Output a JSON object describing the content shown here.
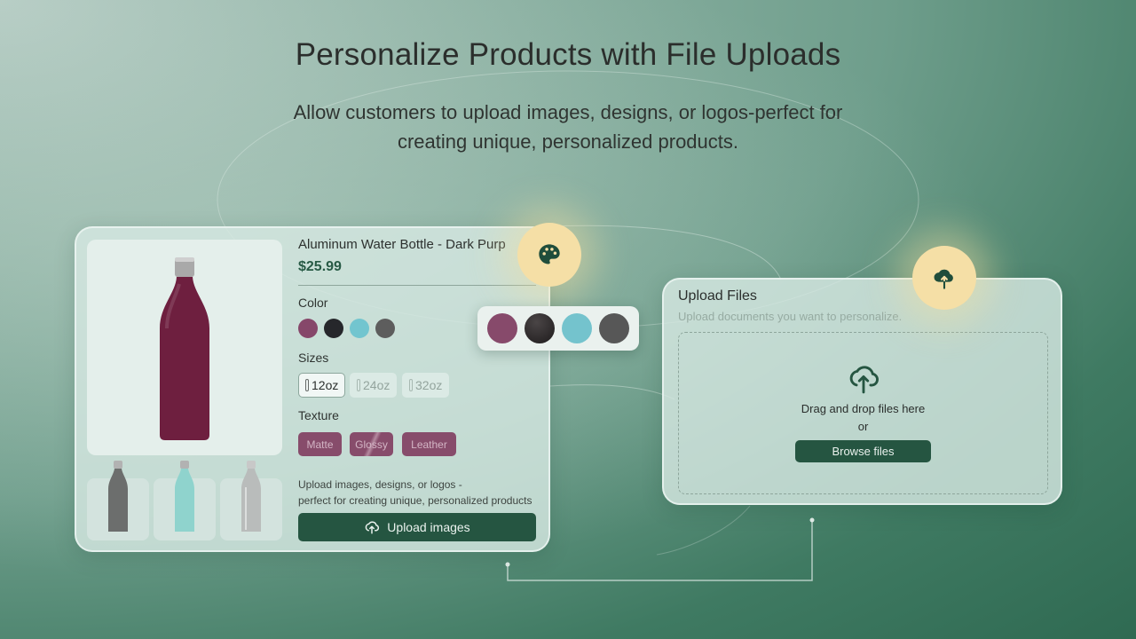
{
  "hero": {
    "title": "Personalize Products with File Uploads",
    "subtitle": "Allow customers to upload images, designs, or logos-perfect for creating unique, personalized products."
  },
  "product": {
    "title": "Aluminum Water Bottle - Dark Purp",
    "price": "$25.99",
    "main_image_color": "#6e1f3f",
    "thumbnails": [
      {
        "name": "gray",
        "color": "#6c6e6d"
      },
      {
        "name": "teal",
        "color": "#8fd3cd"
      },
      {
        "name": "silver",
        "color": "#b9bcbb"
      }
    ],
    "color_label": "Color",
    "colors": [
      {
        "name": "dark-purple",
        "hex": "#86476a"
      },
      {
        "name": "black",
        "hex": "#26272b"
      },
      {
        "name": "light-blue",
        "hex": "#72c5cf"
      },
      {
        "name": "gray",
        "hex": "#5d5d5d"
      }
    ],
    "sizes_label": "Sizes",
    "sizes": [
      {
        "label": "12oz",
        "selected": true
      },
      {
        "label": "24oz",
        "selected": false
      },
      {
        "label": "32oz",
        "selected": false
      }
    ],
    "texture_label": "Texture",
    "textures": [
      "Matte",
      "Glossy",
      "Leather"
    ],
    "help_line1": "Upload images, designs, or logos -",
    "help_line2": "perfect for creating unique, personalized products",
    "upload_button": "Upload images"
  },
  "color_popover": {
    "colors": [
      {
        "name": "dark-purple",
        "hex": "#874a6b"
      },
      {
        "name": "black",
        "hex": "#2e2b2c"
      },
      {
        "name": "light-blue",
        "hex": "#74c3cd"
      },
      {
        "name": "gray",
        "hex": "#575757"
      }
    ]
  },
  "upload_panel": {
    "title": "Upload Files",
    "subtitle": "Upload documents you want to personalize.",
    "drop_text": "Drag and drop files here",
    "or_text": "or",
    "browse_button": "Browse files"
  },
  "icons": {
    "palette": "palette-icon",
    "cloud_upload": "cloud-upload-icon"
  },
  "colors": {
    "accent": "#255541",
    "badge": "#f5dfa6",
    "texture_chip": "#874c6b"
  }
}
